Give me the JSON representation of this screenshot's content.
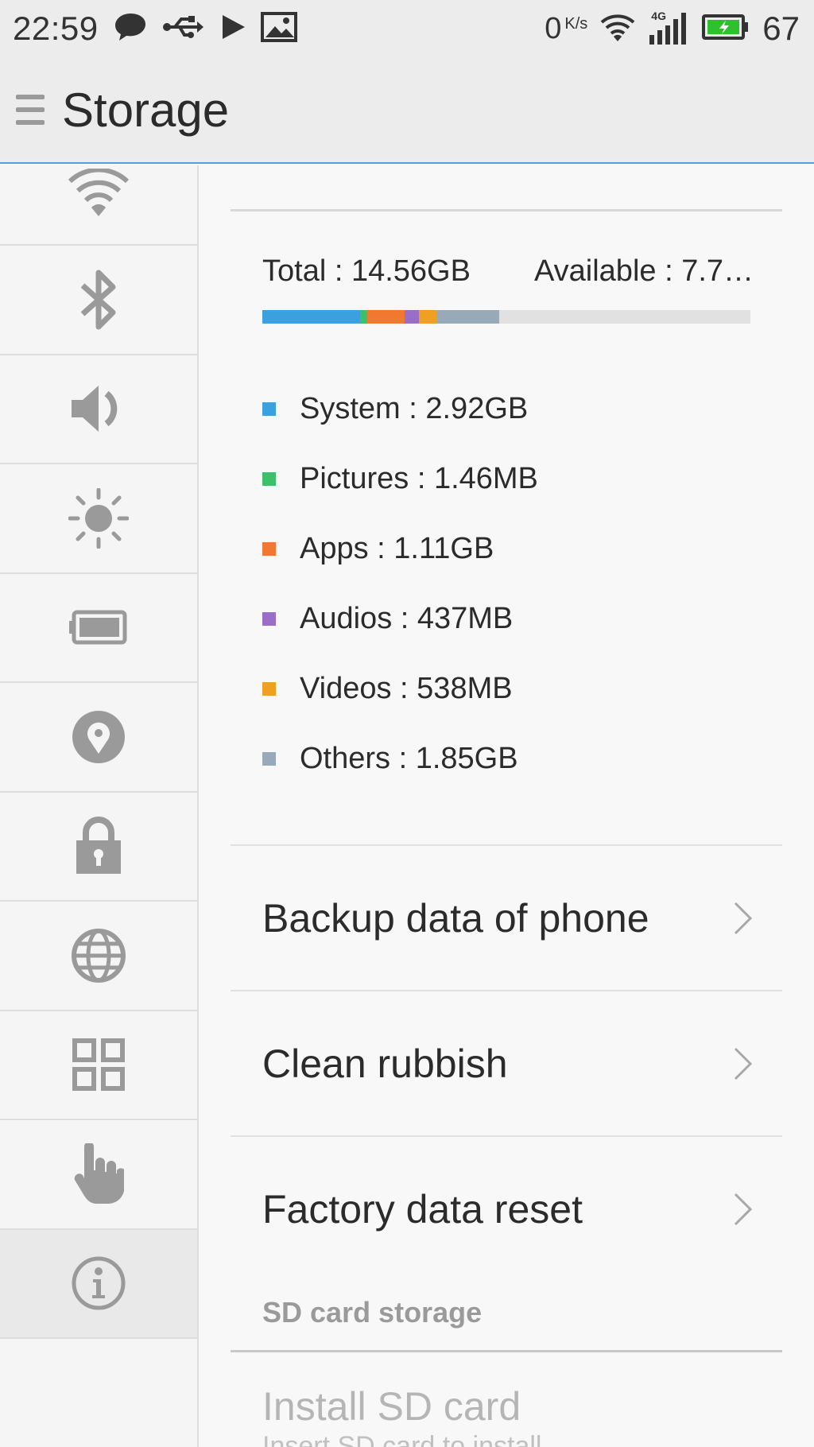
{
  "status_bar": {
    "time": "22:59",
    "net_speed_value": "0",
    "net_speed_unit": "K/s",
    "network_type": "4G",
    "battery_percent": "67",
    "icons": [
      "message-icon",
      "usb-icon",
      "play-icon",
      "image-icon",
      "wifi-icon",
      "signal-icon",
      "battery-charging-icon"
    ]
  },
  "app_bar": {
    "title": "Storage",
    "menu_icon": "menu-icon"
  },
  "sidebar": {
    "items": [
      {
        "name": "wifi",
        "icon": "wifi-icon"
      },
      {
        "name": "bluetooth",
        "icon": "bluetooth-icon"
      },
      {
        "name": "sound",
        "icon": "volume-icon"
      },
      {
        "name": "display",
        "icon": "brightness-icon"
      },
      {
        "name": "battery",
        "icon": "battery-icon"
      },
      {
        "name": "location",
        "icon": "location-pin-icon"
      },
      {
        "name": "security",
        "icon": "lock-icon"
      },
      {
        "name": "language",
        "icon": "globe-icon"
      },
      {
        "name": "apps",
        "icon": "grid-icon"
      },
      {
        "name": "gestures",
        "icon": "hand-icon"
      },
      {
        "name": "about",
        "icon": "info-icon",
        "active": true
      }
    ]
  },
  "storage": {
    "total_text": "Total : 14.56GB",
    "available_text": "Available : 7.7…",
    "usage_fractions": {
      "system": 0.2,
      "pictures": 0.015,
      "apps": 0.076,
      "audios": 0.03,
      "videos": 0.037,
      "others": 0.127
    },
    "legend": [
      {
        "label": "System : 2.92GB",
        "color": "#3aa0e0"
      },
      {
        "label": "Pictures : 1.46MB",
        "color": "#3cc06a"
      },
      {
        "label": "Apps : 1.11GB",
        "color": "#f07830"
      },
      {
        "label": "Audios : 437MB",
        "color": "#9a6ec8"
      },
      {
        "label": "Videos : 538MB",
        "color": "#f0a020"
      },
      {
        "label": "Others : 1.85GB",
        "color": "#98aab8"
      }
    ],
    "free_color": "#e1e1e1"
  },
  "menu": {
    "backup": "Backup data of phone",
    "clean": "Clean rubbish",
    "reset": "Factory data reset"
  },
  "sd_card": {
    "section_title": "SD card storage",
    "install_title": "Install SD card",
    "install_subtitle": "Insert SD card to install"
  }
}
